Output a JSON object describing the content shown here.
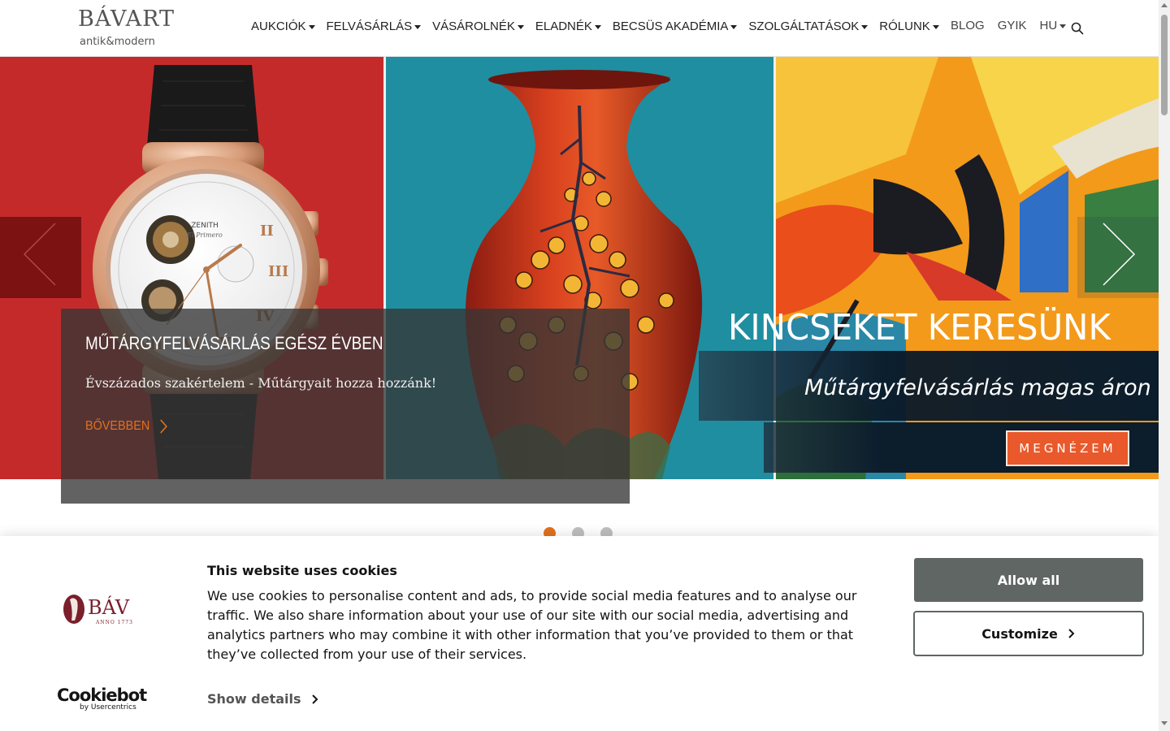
{
  "header": {
    "logo": {
      "line1": "BÁVART",
      "line2": "antik&modern"
    },
    "nav": [
      {
        "label": "AUKCIÓK"
      },
      {
        "label": "FELVÁSÁRLÁS"
      },
      {
        "label": "VÁSÁROLNÉK"
      },
      {
        "label": "ELADNÉK"
      },
      {
        "label": "BECSÜS AKADÉMIA"
      },
      {
        "label": "SZOLGÁLTATÁSOK"
      },
      {
        "label": "RÓLUNK"
      }
    ],
    "right_nav": {
      "blog": "BLOG",
      "faq": "GYIK",
      "language": "HU"
    },
    "search_icon": "search-icon"
  },
  "hero": {
    "caption": {
      "title": "MŰTÁRGYFELVÁSÁRLÁS EGÉSZ ÉVBEN",
      "subtitle": "Évszázados szakértelem - Műtárgyait hozza hozzánk!",
      "more": "BŐVEBBEN"
    },
    "banner": {
      "headline": "KINCSEKET KERESÜNK",
      "subline": "Műtárgyfelvásárlás magas áron",
      "button": "MEGNÉZEM"
    },
    "watch_text": {
      "brand": "ZENITH",
      "sub": "El Primero"
    },
    "slides": {
      "count": 3,
      "active": 1
    }
  },
  "cookie": {
    "logo_text": "BÁV",
    "logo_sub": "ANNO 1773",
    "title": "This website uses cookies",
    "text": "We use cookies to personalise content and ads, to provide social media features and to analyse our traffic. We also share information about your use of our site with our social media, advertising and analytics partners who may combine it with other information that you’ve provided to them or that they’ve collected from your use of their services.",
    "show_details": "Show details",
    "allow_all": "Allow all",
    "customize": "Customize",
    "cookiebot": "Cookiebot",
    "cookiebot_sub": "by Usercentrics"
  },
  "colors": {
    "accent": "#e2711d",
    "hero_red": "#c52a2a",
    "hero_teal": "#1f8ea0",
    "banner_navy": "#0c1d2c",
    "button_gray": "#5f6663"
  }
}
